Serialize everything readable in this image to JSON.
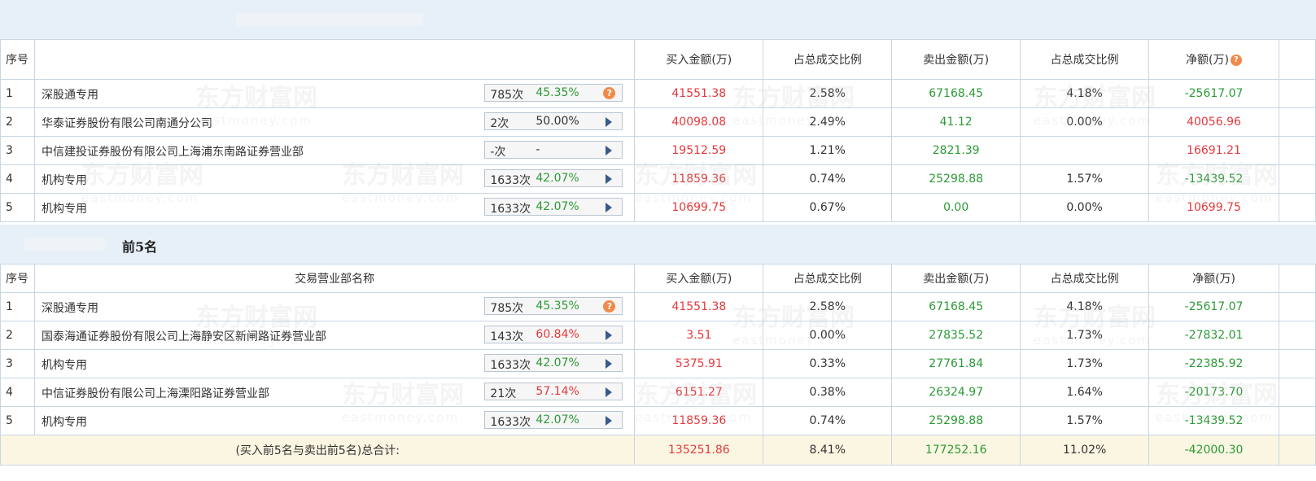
{
  "section2_title": "前5名",
  "buy_table": {
    "headers": {
      "idx": "序号",
      "buy": "买入金额(万)",
      "buy_ratio": "占总成交比例",
      "sell": "卖出金额(万)",
      "sell_ratio": "占总成交比例",
      "net": "净额(万)"
    },
    "rows": [
      {
        "idx": "1",
        "name": "深股通专用",
        "count": "785次",
        "pct": "45.35%",
        "pct_color": "green",
        "icon": "question-icon",
        "buy": "41551.38",
        "buy_ratio": "2.58%",
        "sell": "67168.45",
        "sell_ratio": "4.18%",
        "net": "-25617.07",
        "net_color": "green"
      },
      {
        "idx": "2",
        "name": "华泰证券股份有限公司南通分公司",
        "count": "2次",
        "pct": "50.00%",
        "pct_color": "dark",
        "icon": "play-arrow-icon",
        "buy": "40098.08",
        "buy_ratio": "2.49%",
        "sell": "41.12",
        "sell_ratio": "0.00%",
        "net": "40056.96",
        "net_color": "red"
      },
      {
        "idx": "3",
        "name": "中信建投证券股份有限公司上海浦东南路证券营业部",
        "count": "-次",
        "pct": "-",
        "pct_color": "dark",
        "icon": "play-arrow-icon",
        "buy": "19512.59",
        "buy_ratio": "1.21%",
        "sell": "2821.39",
        "sell_ratio": "",
        "net": "16691.21",
        "net_color": "red"
      },
      {
        "idx": "4",
        "name": "机构专用",
        "count": "1633次",
        "pct": "42.07%",
        "pct_color": "green",
        "icon": "play-arrow-icon",
        "buy": "11859.36",
        "buy_ratio": "0.74%",
        "sell": "25298.88",
        "sell_ratio": "1.57%",
        "net": "-13439.52",
        "net_color": "green"
      },
      {
        "idx": "5",
        "name": "机构专用",
        "count": "1633次",
        "pct": "42.07%",
        "pct_color": "green",
        "icon": "play-arrow-icon",
        "buy": "10699.75",
        "buy_ratio": "0.67%",
        "sell": "0.00",
        "sell_ratio": "0.00%",
        "net": "10699.75",
        "net_color": "red"
      }
    ]
  },
  "sell_table": {
    "headers": {
      "idx": "序号",
      "name": "交易营业部名称",
      "buy": "买入金额(万)",
      "buy_ratio": "占总成交比例",
      "sell": "卖出金额(万)",
      "sell_ratio": "占总成交比例",
      "net": "净额(万)"
    },
    "rows": [
      {
        "idx": "1",
        "name": "深股通专用",
        "count": "785次",
        "pct": "45.35%",
        "pct_color": "green",
        "icon": "question-icon",
        "buy": "41551.38",
        "buy_ratio": "2.58%",
        "sell": "67168.45",
        "sell_ratio": "4.18%",
        "net": "-25617.07",
        "net_color": "green"
      },
      {
        "idx": "2",
        "name": "国泰海通证券股份有限公司上海静安区新闸路证券营业部",
        "count": "143次",
        "pct": "60.84%",
        "pct_color": "red",
        "icon": "play-arrow-icon",
        "buy": "3.51",
        "buy_ratio": "0.00%",
        "sell": "27835.52",
        "sell_ratio": "1.73%",
        "net": "-27832.01",
        "net_color": "green"
      },
      {
        "idx": "3",
        "name": "机构专用",
        "count": "1633次",
        "pct": "42.07%",
        "pct_color": "green",
        "icon": "play-arrow-icon",
        "buy": "5375.91",
        "buy_ratio": "0.33%",
        "sell": "27761.84",
        "sell_ratio": "1.73%",
        "net": "-22385.92",
        "net_color": "green"
      },
      {
        "idx": "4",
        "name": "中信证券股份有限公司上海溧阳路证券营业部",
        "count": "21次",
        "pct": "57.14%",
        "pct_color": "red",
        "icon": "play-arrow-icon",
        "buy": "6151.27",
        "buy_ratio": "0.38%",
        "sell": "26324.97",
        "sell_ratio": "1.64%",
        "net": "-20173.70",
        "net_color": "green"
      },
      {
        "idx": "5",
        "name": "机构专用",
        "count": "1633次",
        "pct": "42.07%",
        "pct_color": "green",
        "icon": "play-arrow-icon",
        "buy": "11859.36",
        "buy_ratio": "0.74%",
        "sell": "25298.88",
        "sell_ratio": "1.57%",
        "net": "-13439.52",
        "net_color": "green"
      }
    ],
    "total": {
      "label": "(买入前5名与卖出前5名)总合计:",
      "buy": "135251.86",
      "buy_ratio": "8.41%",
      "sell": "177252.16",
      "sell_ratio": "11.02%",
      "net": "-42000.30"
    }
  },
  "watermark": {
    "cn": "东方财富网",
    "en": "eastmoney.com"
  },
  "colors": {
    "red": "#e4393c",
    "green": "#2b9a36",
    "header_band": "#e7f0f8",
    "total_row": "#fbf6e2",
    "border": "#c7d6e4",
    "icon_orange": "#f08a4b"
  }
}
